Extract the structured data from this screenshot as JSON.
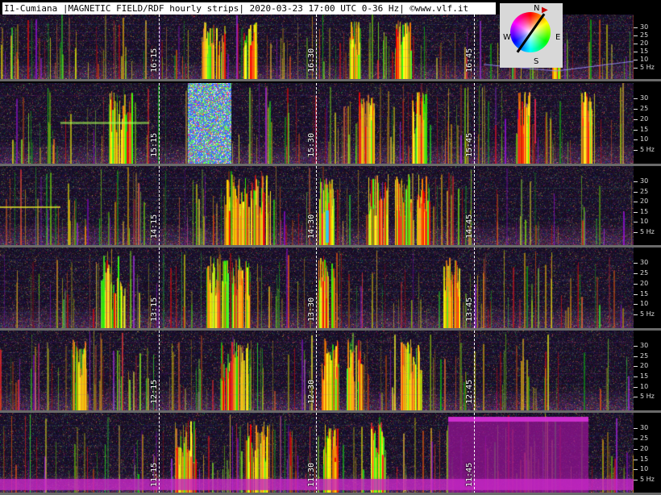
{
  "title": "I1-Cumiana |MAGNETIC FIELD/RDF hourly strips| 2020-03-23 17:00 UTC 0-36 Hz| ©www.vlf.it",
  "compass": {
    "north": "N",
    "south": "S",
    "east": "E",
    "west": "W"
  },
  "freq_ticks": [
    "30",
    "25",
    "20",
    "15",
    "10",
    "5 Hz"
  ],
  "strips": [
    {
      "labels": [
        "16:15",
        "16:30",
        "16:45"
      ]
    },
    {
      "labels": [
        "15:15",
        "15:30",
        "15:45"
      ]
    },
    {
      "labels": [
        "14:15",
        "14:30",
        "14:45"
      ]
    },
    {
      "labels": [
        "13:15",
        "13:30",
        "13:45"
      ]
    },
    {
      "labels": [
        "12:15",
        "12:30",
        "12:45"
      ]
    },
    {
      "labels": [
        "11:15",
        "11:30",
        "11:45"
      ]
    }
  ],
  "colors": {
    "background": "#000000",
    "title_bg": "#ffffff",
    "separator": "#6a6a6a"
  }
}
